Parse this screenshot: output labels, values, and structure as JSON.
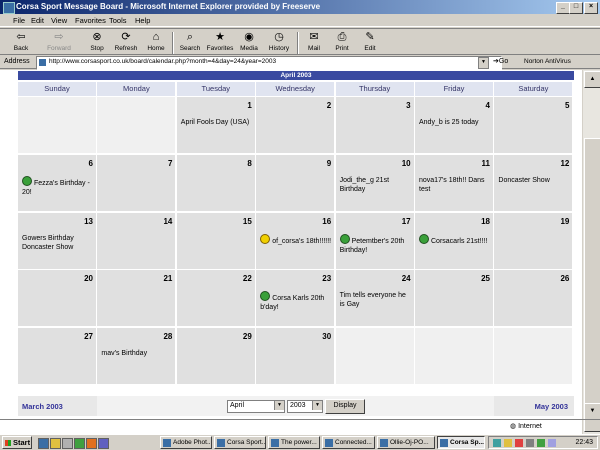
{
  "window": {
    "title": "Corsa Sport Message Board - Microsoft Internet Explorer provided by Freeserve"
  },
  "menu": [
    "File",
    "Edit",
    "View",
    "Favorites",
    "Tools",
    "Help"
  ],
  "toolbar": {
    "back": "Back",
    "forward": "Forward",
    "stop": "Stop",
    "refresh": "Refresh",
    "home": "Home",
    "search": "Search",
    "favorites": "Favorites",
    "media": "Media",
    "history": "History",
    "mail": "Mail",
    "print": "Print",
    "edit": "Edit"
  },
  "address": {
    "label": "Address",
    "url": "http://www.corsasport.co.uk/board/calendar.php?month=4&day=24&year=2003",
    "go": "Go",
    "norton": "Norton AntiVirus"
  },
  "calendar": {
    "title": "April 2003",
    "daynames": [
      "Sunday",
      "Monday",
      "Tuesday",
      "Wednesday",
      "Thursday",
      "Friday",
      "Saturday"
    ],
    "weeks": [
      [
        {
          "num": "",
          "event": "",
          "icon": ""
        },
        {
          "num": "",
          "event": "",
          "icon": ""
        },
        {
          "num": "1",
          "event": "April Fools Day (USA)",
          "icon": ""
        },
        {
          "num": "2",
          "event": "",
          "icon": ""
        },
        {
          "num": "3",
          "event": "",
          "icon": ""
        },
        {
          "num": "4",
          "event": "Andy_b is 25 today",
          "icon": ""
        },
        {
          "num": "5",
          "event": "",
          "icon": ""
        }
      ],
      [
        {
          "num": "6",
          "event": "Fezza's Birthday - 20!",
          "icon": "green"
        },
        {
          "num": "7",
          "event": "",
          "icon": ""
        },
        {
          "num": "8",
          "event": "",
          "icon": ""
        },
        {
          "num": "9",
          "event": "",
          "icon": ""
        },
        {
          "num": "10",
          "event": "Jodi_the_g 21st Birthday",
          "icon": ""
        },
        {
          "num": "11",
          "event": "nova17's 18th!! Dans test",
          "icon": ""
        },
        {
          "num": "12",
          "event": "Doncaster Show",
          "icon": ""
        }
      ],
      [
        {
          "num": "13",
          "event": "Gowers Birthday Doncaster Show",
          "icon": ""
        },
        {
          "num": "14",
          "event": "",
          "icon": ""
        },
        {
          "num": "15",
          "event": "",
          "icon": ""
        },
        {
          "num": "16",
          "event": "of_corsa's 18th!!!!!!",
          "icon": "yellow"
        },
        {
          "num": "17",
          "event": "Petemtber's 20th Birthday!",
          "icon": "green"
        },
        {
          "num": "18",
          "event": "Corsacarls 21st!!!!",
          "icon": "green"
        },
        {
          "num": "19",
          "event": "",
          "icon": ""
        }
      ],
      [
        {
          "num": "20",
          "event": "",
          "icon": ""
        },
        {
          "num": "21",
          "event": "",
          "icon": ""
        },
        {
          "num": "22",
          "event": "",
          "icon": ""
        },
        {
          "num": "23",
          "event": "Corsa Karls 20th b'day!",
          "icon": "green"
        },
        {
          "num": "24",
          "event": "Tim tells everyone he is Gay",
          "icon": ""
        },
        {
          "num": "25",
          "event": "",
          "icon": ""
        },
        {
          "num": "26",
          "event": "",
          "icon": ""
        }
      ],
      [
        {
          "num": "27",
          "event": "",
          "icon": ""
        },
        {
          "num": "28",
          "event": "mav's Birthday",
          "icon": ""
        },
        {
          "num": "29",
          "event": "",
          "icon": ""
        },
        {
          "num": "30",
          "event": "",
          "icon": ""
        },
        {
          "num": "",
          "event": "",
          "icon": ""
        },
        {
          "num": "",
          "event": "",
          "icon": ""
        },
        {
          "num": "",
          "event": "",
          "icon": ""
        }
      ]
    ],
    "prev_month": "March 2003",
    "next_month": "May 2003",
    "month_select": "April",
    "year_select": "2003",
    "display_button": "Display"
  },
  "status": {
    "zone": "Internet"
  },
  "taskbar": {
    "start": "Start",
    "tasks": [
      "Adobe Phot...",
      "Corsa Sport...",
      "The power...",
      "Connected...",
      "Ollie-Oj-PO...",
      "Corsa Sp..."
    ],
    "clock": "22:43"
  }
}
